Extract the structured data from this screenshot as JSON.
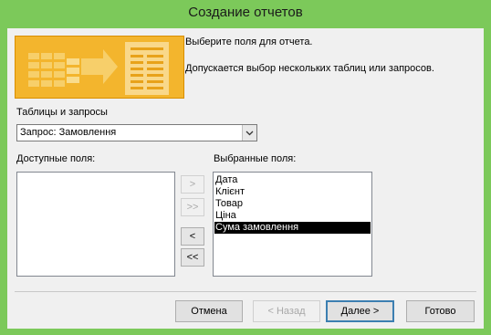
{
  "window": {
    "title": "Создание отчетов"
  },
  "header": {
    "line1": "Выберите поля для отчета.",
    "line2": "Допускается выбор нескольких таблиц или запросов."
  },
  "source": {
    "label": "Таблицы и запросы",
    "selected": "Запрос: Замовлення"
  },
  "available": {
    "label": "Доступные поля:",
    "items": []
  },
  "selected_fields": {
    "label": "Выбранные поля:",
    "items": [
      "Дата",
      "Клієнт",
      "Товар",
      "Ціна",
      "Сума замовлення"
    ],
    "selected_index": 4
  },
  "move_buttons": {
    "add": ">",
    "add_all": ">>",
    "remove": "<",
    "remove_all": "<<"
  },
  "footer": {
    "cancel": "Отмена",
    "back": "< Назад",
    "next": "Далее >",
    "finish": "Готово"
  },
  "colors": {
    "title_bar": "#7cc95a",
    "illustration": "#f3b52d",
    "dialog_bg": "#f0f0f0",
    "selection": "#000000"
  }
}
